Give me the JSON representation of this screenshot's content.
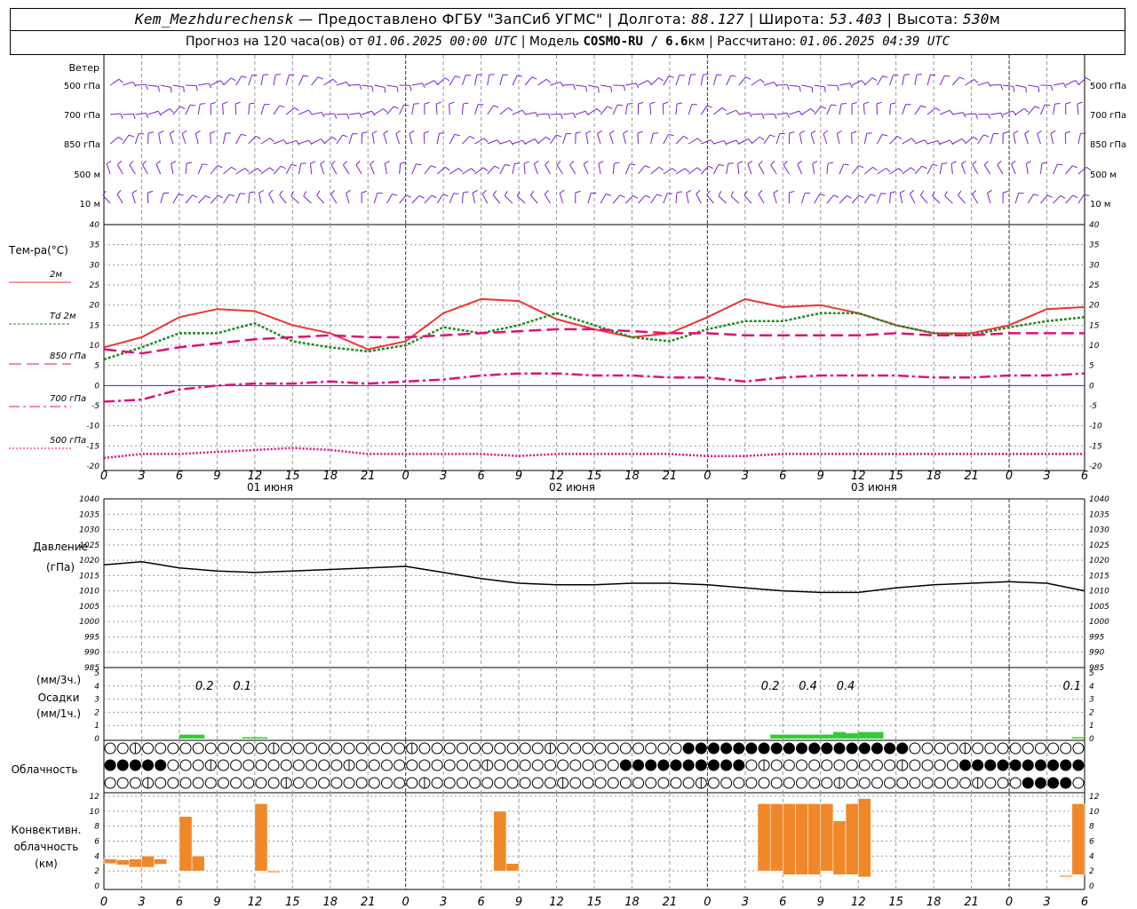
{
  "header": {
    "station": "Kem_Mezhdurechensk",
    "dash": " — ",
    "provider": "Предоставлено ФГБУ \"ЗапСиб УГМС\"",
    "sep": " | ",
    "lon_label": "Долгота: ",
    "lon": "88.127",
    "lat_label": "Широта: ",
    "lat": "53.403",
    "alt_label": "Высота: ",
    "alt": "530",
    "alt_unit": "м",
    "forecast_label": "Прогноз на 120 часа(ов) от ",
    "forecast_start": "01.06.2025 00:00 UTC",
    "model_label": "Модель ",
    "model": "COSMO-RU / 6.6",
    "model_unit": "км",
    "calc_label": "Рассчитано: ",
    "calc_time": "01.06.2025 04:39 UTC"
  },
  "wind_panel": {
    "title": "Ветер",
    "levels": [
      "500 гПа",
      "700 гПа",
      "850 гПа",
      "500 м",
      "10 м"
    ],
    "right_levels": [
      "500 гПа",
      "700 гПа",
      "850 гПа",
      "500 м",
      "10 м"
    ]
  },
  "temp_panel": {
    "title": "Тем-ра(°С)",
    "legend": [
      {
        "label": "2м",
        "color": "#ee3333",
        "style": "solid"
      },
      {
        "label": "Td  2м",
        "color": "#228822",
        "style": "dotted"
      },
      {
        "label": "850 гПа",
        "color": "#dd1177",
        "style": "dashed"
      },
      {
        "label": "700 гПа",
        "color": "#dd1177",
        "style": "dashdot"
      },
      {
        "label": "500 гПа",
        "color": "#dd1177",
        "style": "dotted"
      }
    ]
  },
  "pressure_panel": {
    "title": "Давление",
    "unit": "(гПа)"
  },
  "precip_panel": {
    "unit3": "(мм/3ч.)",
    "title": "Осадки",
    "unit1": "(мм/1ч.)",
    "labels": [
      {
        "x": 8,
        "text": "0.2"
      },
      {
        "x": 11,
        "text": "0.1"
      },
      {
        "x": 53,
        "text": "0.2"
      },
      {
        "x": 56,
        "text": "0.4"
      },
      {
        "x": 59,
        "text": "0.4"
      },
      {
        "x": 77,
        "text": "0.1"
      }
    ]
  },
  "cloud_panel": {
    "title": "Облачность"
  },
  "conv_panel": {
    "title1": "Конвективн.",
    "title2": "облачность",
    "unit": "(км)"
  },
  "time_axis": {
    "hour_labels": [
      "0",
      "3",
      "6",
      "9",
      "12",
      "15",
      "18",
      "21"
    ],
    "days": [
      "01 июня",
      "02 июня",
      "03 июня"
    ]
  },
  "chart_data": [
    {
      "type": "line",
      "title": "Тем-ра(°С)",
      "x_hours": [
        0,
        3,
        6,
        9,
        12,
        15,
        18,
        21,
        24,
        27,
        30,
        33,
        36,
        39,
        42,
        45,
        48,
        51,
        54,
        57,
        60,
        63,
        66,
        69,
        72,
        75,
        78
      ],
      "ylim": [
        -20,
        40
      ],
      "series": [
        {
          "name": "2м",
          "values": [
            9.5,
            12,
            17,
            19,
            18.5,
            15,
            13,
            9,
            11,
            18,
            21.5,
            21,
            16.5,
            14,
            12,
            13,
            17,
            21.5,
            19.5,
            20,
            18,
            15,
            13,
            13,
            15,
            19,
            19.5
          ]
        },
        {
          "name": "Td  2м",
          "values": [
            6.5,
            9.5,
            13,
            13,
            15.5,
            11,
            9.5,
            8.5,
            10,
            14.5,
            13,
            15,
            18,
            15,
            12,
            11,
            14,
            16,
            16,
            18,
            18,
            15,
            13,
            12.5,
            14.5,
            16,
            17
          ]
        },
        {
          "name": "850 гПа",
          "values": [
            9,
            8,
            9.5,
            10.5,
            11.5,
            12,
            12.5,
            12,
            12,
            12.5,
            13,
            13.5,
            14,
            14,
            13.5,
            13,
            13,
            12.5,
            12.5,
            12.5,
            12.5,
            13,
            12.5,
            12.5,
            13,
            13,
            13
          ]
        },
        {
          "name": "700 гПа",
          "values": [
            -4,
            -3.5,
            -1,
            0,
            0.5,
            0.5,
            1,
            0.5,
            1,
            1.5,
            2.5,
            3,
            3,
            2.5,
            2.5,
            2,
            2,
            1,
            2,
            2.5,
            2.5,
            2.5,
            2,
            2,
            2.5,
            2.5,
            3
          ]
        },
        {
          "name": "500 гПа",
          "values": [
            -18,
            -17,
            -17,
            -16.5,
            -16,
            -15.5,
            -16,
            -17,
            -17,
            -17,
            -17,
            -17.5,
            -17,
            -17,
            -17,
            -17,
            -17.5,
            -17.5,
            -17,
            -17,
            -17,
            -17,
            -17,
            -17,
            -17,
            -17,
            -17
          ]
        }
      ]
    },
    {
      "type": "line",
      "title": "Давление",
      "x_hours": [
        0,
        3,
        6,
        9,
        12,
        15,
        18,
        21,
        24,
        27,
        30,
        33,
        36,
        39,
        42,
        45,
        48,
        51,
        54,
        57,
        60,
        63,
        66,
        69,
        72,
        75,
        78
      ],
      "ylim": [
        985,
        1040
      ],
      "series": [
        {
          "name": "Давление",
          "values": [
            1018.5,
            1019.5,
            1017.5,
            1016.5,
            1016,
            1016.5,
            1017,
            1017.5,
            1018,
            1016,
            1014,
            1012.5,
            1012,
            1012,
            1012.5,
            1012.5,
            1012,
            1011,
            1010,
            1009.5,
            1009.5,
            1011,
            1012,
            1012.5,
            1013,
            1012.5,
            1010
          ]
        }
      ]
    },
    {
      "type": "bar",
      "title": "Осадки",
      "ylim": [
        0,
        5
      ],
      "x_hours": [
        6,
        7,
        11,
        12,
        53,
        54,
        55,
        56,
        57,
        58,
        59,
        60,
        61,
        77
      ],
      "values": [
        0.3,
        0.3,
        0.1,
        0.1,
        0.3,
        0.3,
        0.3,
        0.3,
        0.3,
        0.5,
        0.4,
        0.5,
        0.5,
        0.1
      ]
    },
    {
      "type": "bar",
      "title": "Конвективн. облачность (км)",
      "ylim": [
        0,
        12
      ],
      "ranges": [
        {
          "x": [
            0,
            1
          ],
          "base": 3.0,
          "top": 3.6
        },
        {
          "x": [
            1,
            2
          ],
          "base": 2.8,
          "top": 3.5
        },
        {
          "x": [
            2,
            3
          ],
          "base": 2.5,
          "top": 3.6
        },
        {
          "x": [
            3,
            4
          ],
          "base": 2.5,
          "top": 4.0
        },
        {
          "x": [
            4,
            5
          ],
          "base": 2.9,
          "top": 3.6
        },
        {
          "x": [
            6,
            7
          ],
          "base": 2.0,
          "top": 9.3
        },
        {
          "x": [
            7,
            8
          ],
          "base": 2.0,
          "top": 4.0
        },
        {
          "x": [
            12,
            13
          ],
          "base": 2.0,
          "top": 11.0
        },
        {
          "x": [
            13,
            14
          ],
          "base": 1.8,
          "top": 2.0
        },
        {
          "x": [
            31,
            32
          ],
          "base": 2.0,
          "top": 10.0
        },
        {
          "x": [
            32,
            33
          ],
          "base": 2.0,
          "top": 3.0
        },
        {
          "x": [
            52,
            53
          ],
          "base": 2.0,
          "top": 11.0
        },
        {
          "x": [
            53,
            54
          ],
          "base": 2.0,
          "top": 11.0
        },
        {
          "x": [
            54,
            55
          ],
          "base": 1.5,
          "top": 11.0
        },
        {
          "x": [
            55,
            56
          ],
          "base": 1.5,
          "top": 11.0
        },
        {
          "x": [
            56,
            57
          ],
          "base": 1.5,
          "top": 11.0
        },
        {
          "x": [
            57,
            58
          ],
          "base": 2.0,
          "top": 11.0
        },
        {
          "x": [
            58,
            59
          ],
          "base": 1.5,
          "top": 8.7
        },
        {
          "x": [
            59,
            60
          ],
          "base": 1.5,
          "top": 11.0
        },
        {
          "x": [
            60,
            61
          ],
          "base": 1.2,
          "top": 11.7
        },
        {
          "x": [
            76,
            77
          ],
          "base": 1.2,
          "top": 1.4
        },
        {
          "x": [
            77,
            78
          ],
          "base": 1.5,
          "top": 11.0
        }
      ]
    }
  ],
  "colors": {
    "wind": "#7a22cc",
    "t2m": "#ee3333",
    "td": "#228822",
    "upper": "#dd1177",
    "zero": "#3333cc",
    "precip": "#33cc33",
    "conv": "#f0882a",
    "grid": "#999999"
  }
}
